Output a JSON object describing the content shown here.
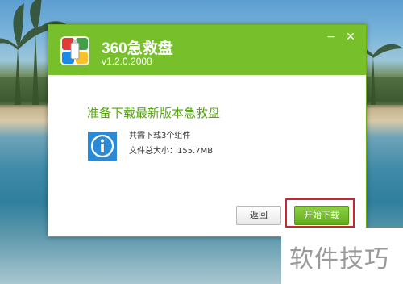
{
  "window": {
    "app_title": "360急救盘",
    "version": "v1.2.0.2008",
    "minimize_symbol": "−",
    "close_symbol": "✕"
  },
  "content": {
    "heading": "准备下载最新版本急救盘",
    "info_icon": "info-icon",
    "components_line": "共需下载3个组件",
    "size_line": "文件总大小：155.7MB"
  },
  "buttons": {
    "back": "返回",
    "start": "开始下载"
  },
  "watermark": "软件技巧",
  "colors": {
    "accent_green": "#77c02b",
    "heading_green": "#54a60c",
    "info_blue": "#2a8ad5",
    "highlight_red": "#c9262e"
  }
}
